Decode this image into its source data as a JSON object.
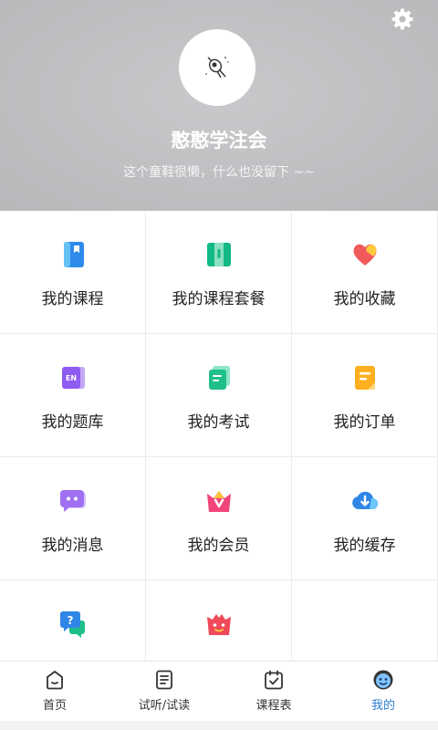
{
  "profile": {
    "username": "憨憨学注会",
    "bio": "这个童鞋很懒，什么也没留下 ~~"
  },
  "menu": [
    {
      "label": "我的课程",
      "icon": "course-book-icon"
    },
    {
      "label": "我的课程套餐",
      "icon": "course-package-icon"
    },
    {
      "label": "我的收藏",
      "icon": "favorite-heart-icon"
    },
    {
      "label": "我的题库",
      "icon": "question-bank-icon"
    },
    {
      "label": "我的考试",
      "icon": "exam-scroll-icon"
    },
    {
      "label": "我的订单",
      "icon": "order-note-icon"
    },
    {
      "label": "我的消息",
      "icon": "message-bubble-icon"
    },
    {
      "label": "我的会员",
      "icon": "vip-crown-icon"
    },
    {
      "label": "我的缓存",
      "icon": "cloud-download-icon"
    },
    {
      "label": "",
      "icon": "question-help-icon"
    },
    {
      "label": "",
      "icon": "gift-bag-icon"
    }
  ],
  "tabs": [
    {
      "label": "首页",
      "icon": "home-icon"
    },
    {
      "label": "试听/试读",
      "icon": "trial-doc-icon"
    },
    {
      "label": "课程表",
      "icon": "calendar-check-icon"
    },
    {
      "label": "我的",
      "icon": "profile-face-icon",
      "active": true
    }
  ],
  "colors": {
    "header_bg": "#bdbcbf",
    "accent": "#2f7fd1"
  }
}
